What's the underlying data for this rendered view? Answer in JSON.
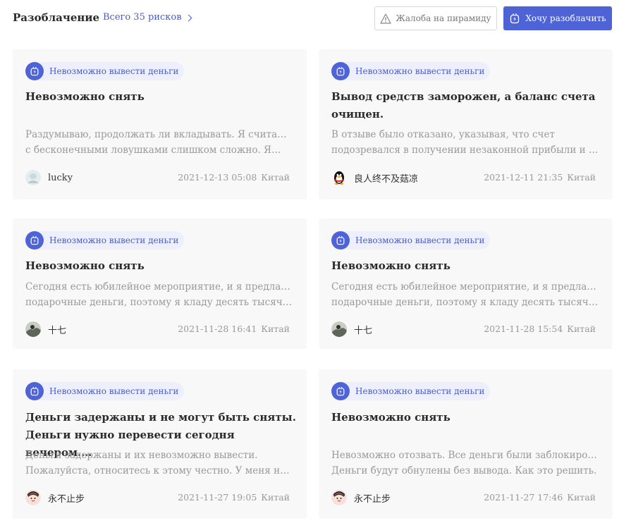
{
  "header": {
    "title": "Разоблачение",
    "total_link": "Всего 35 рисков",
    "complaint_button": "Жалоба на пирамиду",
    "expose_button": "Хочу разоблачить"
  },
  "cards": [
    {
      "tag": "Невозможно вывести деньги",
      "title": "Невозможно снять",
      "desc_lines": [
        "Раздумываю, продолжать ли вкладывать. Я считаю, что",
        "с бесконечными ловушками слишком сложно. Я…"
      ],
      "author": "lucky",
      "avatar": "avatar-light",
      "date": "2021-12-13 05:08",
      "country": "Китай"
    },
    {
      "tag": "Невозможно вывести деньги",
      "title": "Вывод средств заморожен, а баланс счета очищен.",
      "desc_lines": [
        "В отзыве было отказано, указывая, что счет",
        "подозревался в получении незаконной прибыли и был…"
      ],
      "author": "良人终不及菇凉",
      "avatar": "qq-penguin",
      "date": "2021-12-11 21:35",
      "country": "Китай"
    },
    {
      "tag": "Невозможно вывести деньги",
      "title": "Невозможно снять",
      "desc_lines": [
        "Сегодня есть юбилейное мероприятие, и я предлагаю",
        "подарочные деньги, поэтому я кладу десять тысяч, но…"
      ],
      "author": "十七",
      "avatar": "avatar-photo",
      "date": "2021-11-28 16:41",
      "country": "Китай"
    },
    {
      "tag": "Невозможно вывести деньги",
      "title": "Невозможно снять",
      "desc_lines": [
        "Сегодня есть юбилейное мероприятие, и я предлагаю",
        "подарочные деньги, поэтому я кладу десять тысяч, но…"
      ],
      "author": "十七",
      "avatar": "avatar-photo",
      "date": "2021-11-28 15:54",
      "country": "Китай"
    },
    {
      "tag": "Невозможно вывести деньги",
      "title": "Деньги задержаны и не могут быть сняты. Деньги нужно перевести сегодня вечером.…",
      "desc_lines": [
        "Деньги задержаны и их невозможно вывести.",
        "Пожалуйста, относитесь к этому честно. У меня не…"
      ],
      "author": "永不止步",
      "avatar": "avatar-cartoon",
      "date": "2021-11-27 19:05",
      "country": "Китай"
    },
    {
      "tag": "Невозможно вывести деньги",
      "title": "Невозможно снять",
      "desc_lines": [
        "Невозможно отозвать. Все деньги были заблокированы.",
        "Деньги будут обнулены без вывода. Как это решить."
      ],
      "author": "永不止步",
      "avatar": "avatar-cartoon",
      "date": "2021-11-27 17:46",
      "country": "Китай"
    }
  ],
  "colors": {
    "accent": "#4e63d6",
    "card_bg": "#f8f8f9",
    "tag_bg": "#edf0fb",
    "muted_text": "#999999"
  }
}
